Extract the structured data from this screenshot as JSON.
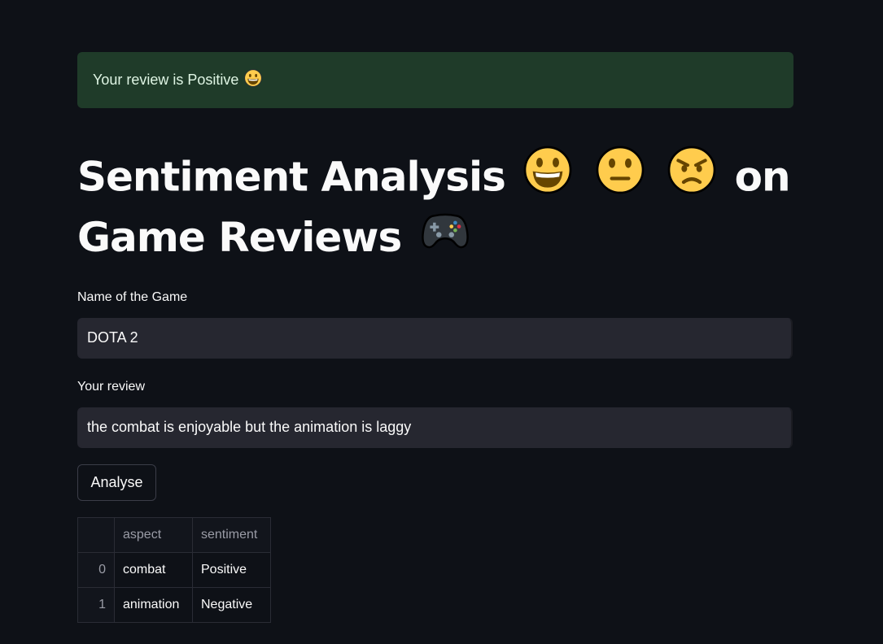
{
  "alert": {
    "text": "Your review is Positive",
    "emoji_icon": "grinning-face-icon"
  },
  "title": {
    "line1": "Sentiment Analysis",
    "word_on": "on",
    "line2": "Game Reviews",
    "icons": [
      "grinning-face-icon",
      "neutral-face-icon",
      "angry-face-icon",
      "game-controller-icon"
    ]
  },
  "form": {
    "game_label": "Name of the Game",
    "game_value": "DOTA 2",
    "review_label": "Your review",
    "review_value": "the combat is enjoyable but the animation is laggy",
    "button_label": "Analyse"
  },
  "table": {
    "columns": [
      "aspect",
      "sentiment"
    ],
    "rows": [
      {
        "index": "0",
        "aspect": "combat",
        "sentiment": "Positive"
      },
      {
        "index": "1",
        "aspect": "animation",
        "sentiment": "Negative"
      }
    ]
  },
  "colors": {
    "background": "#0e1117",
    "success_bg": "#1f3b29",
    "input_bg": "#262730",
    "emoji_yellow": "#ffcc4d"
  }
}
